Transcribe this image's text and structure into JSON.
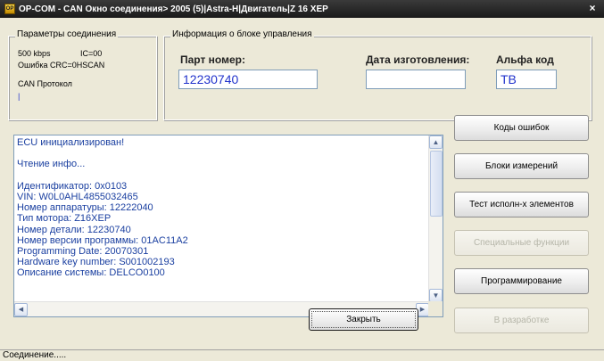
{
  "window": {
    "icon_text": "OP",
    "title": "OP-COM - CAN Окно соединения> 2005 (5)|Astra-H|Двигатель|Z 16 XEP",
    "close_glyph": "×"
  },
  "connection": {
    "legend": "Параметры соединения",
    "speed": "500 kbps",
    "ic": "IC=00",
    "crc": "Ошибка CRC=0HSCAN",
    "protocol_label": "CAN Протокол",
    "protocol_value": "|"
  },
  "ecu_info": {
    "legend": "Информация о блоке управления",
    "part_number_label": "Парт номер:",
    "part_number_value": "12230740",
    "manufacture_date_label": "Дата изготовления:",
    "manufacture_date_value": "",
    "alpha_code_label": "Альфа код",
    "alpha_code_value": "TB"
  },
  "log": {
    "lines": [
      "ECU инициализирован!",
      "",
      "Чтение инфо...",
      "",
      "Идентификатор: 0x0103",
      "VIN: W0L0AHL4855032465",
      "Номер аппаратуры: 12222040",
      "Тип мотора: Z16XEP",
      "Номер детали: 12230740",
      "Номер версии программы: 01AC11A2",
      "Programming Date: 20070301",
      "Hardware key number: S001002193",
      "Описание системы: DELCO0100"
    ],
    "scroll_up_glyph": "▲",
    "scroll_down_glyph": "▼",
    "scroll_left_glyph": "◀",
    "scroll_right_glyph": "▶"
  },
  "buttons": {
    "error_codes": "Коды ошибок",
    "measurement_blocks": "Блоки измерений",
    "actuator_test": "Тест исполн-х элементов",
    "special_functions": "Специальные функции",
    "programming": "Программирование",
    "in_development": "В разработке",
    "close": "Закрыть"
  },
  "status": {
    "text": "Соединение....."
  }
}
